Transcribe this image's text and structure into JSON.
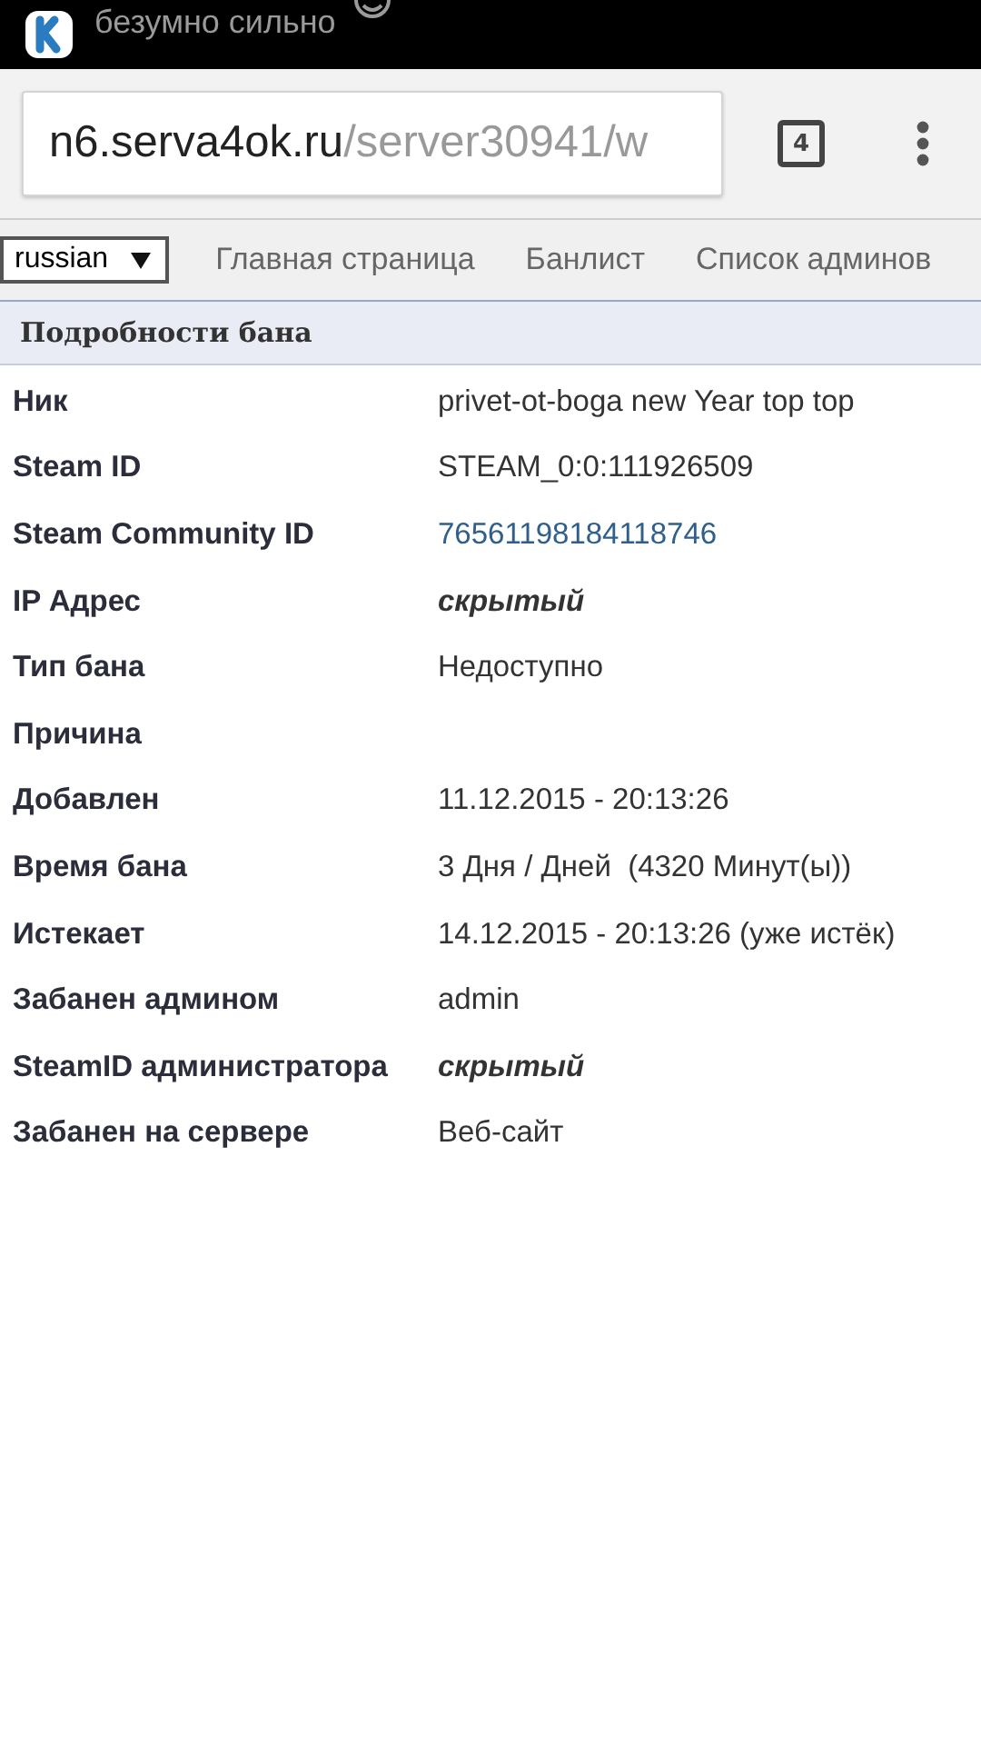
{
  "notification": {
    "text": "безумно сильно"
  },
  "address_bar": {
    "host": "n6.serva4ok.ru",
    "path": "/server30941/w"
  },
  "tab_count": "4",
  "nav": {
    "language": "russian",
    "links": [
      "Главная страница",
      "Банлист",
      "Список админов"
    ]
  },
  "section_title": "Подробности бана",
  "details": [
    {
      "label": "Ник",
      "value": "privet-ot-boga new Year top top",
      "kind": "plain"
    },
    {
      "label": "Steam ID",
      "value": "STEAM_0:0:111926509",
      "kind": "plain"
    },
    {
      "label": "Steam Community ID",
      "value": "76561198184118746",
      "kind": "link"
    },
    {
      "label": "IP Адрес",
      "value": "скрытый",
      "kind": "hidden"
    },
    {
      "label": "Тип бана",
      "value": "Недоступно",
      "kind": "plain"
    },
    {
      "label": "Причина"
    },
    {
      "label": "Добавлен",
      "value": "11.12.2015 - 20:13:26",
      "kind": "plain"
    },
    {
      "label": "Время бана",
      "value": "3 Дня / Дней  (4320 Минут(ы))",
      "kind": "plain"
    },
    {
      "label": "Истекает",
      "value": "14.12.2015 - 20:13:26 (уже истёк)",
      "kind": "plain"
    },
    {
      "label": "Забанен админом",
      "value": "admin",
      "kind": "plain"
    },
    {
      "label": "SteamID администратора",
      "value": "скрытый",
      "kind": "hidden"
    },
    {
      "label": "Забанен на сервере",
      "value": "Веб-сайт",
      "kind": "plain"
    }
  ]
}
